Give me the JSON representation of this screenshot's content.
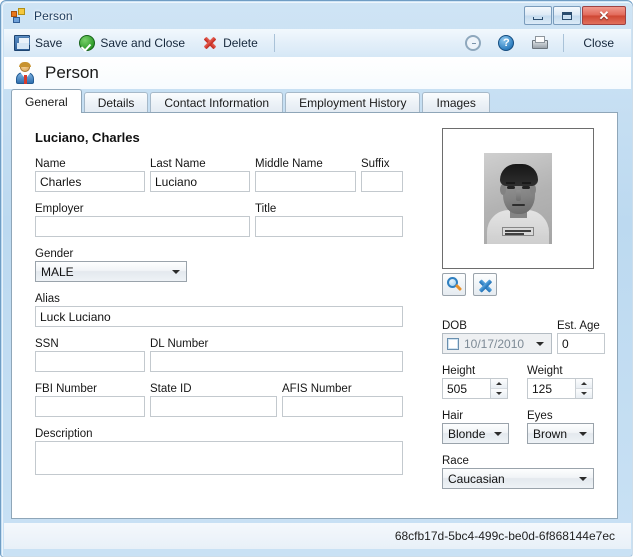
{
  "window": {
    "title": "Person",
    "app_icon": "app-squares-icon",
    "controls": {
      "minimize": "minimize-button",
      "maximize": "maximize-button",
      "close": "close-button"
    }
  },
  "toolbar": {
    "save_label": "Save",
    "save_and_close_label": "Save and Close",
    "delete_label": "Delete",
    "close_label": "Close",
    "icons": {
      "save": "floppy-disk-icon",
      "save_and_close": "green-check-icon",
      "delete": "red-x-icon",
      "history": "clock-history-icon",
      "help": "help-question-icon",
      "print": "printer-icon"
    }
  },
  "header": {
    "title": "Person",
    "icon": "person-icon"
  },
  "tabs": [
    {
      "label": "General",
      "active": true
    },
    {
      "label": "Details",
      "active": false
    },
    {
      "label": "Contact Information",
      "active": false
    },
    {
      "label": "Employment History",
      "active": false
    },
    {
      "label": "Images",
      "active": false
    }
  ],
  "form": {
    "record_title": "Luciano, Charles",
    "name": {
      "label": "Name",
      "value": "Charles"
    },
    "last_name": {
      "label": "Last Name",
      "value": "Luciano"
    },
    "middle_name": {
      "label": "Middle Name",
      "value": ""
    },
    "suffix": {
      "label": "Suffix",
      "value": ""
    },
    "employer": {
      "label": "Employer",
      "value": ""
    },
    "title": {
      "label": "Title",
      "value": ""
    },
    "gender": {
      "label": "Gender",
      "value": "MALE"
    },
    "alias": {
      "label": "Alias",
      "value": "Luck Luciano"
    },
    "ssn": {
      "label": "SSN",
      "value": ""
    },
    "dl_number": {
      "label": "DL Number",
      "value": ""
    },
    "fbi_number": {
      "label": "FBI Number",
      "value": ""
    },
    "state_id": {
      "label": "State ID",
      "value": ""
    },
    "afis_number": {
      "label": "AFIS Number",
      "value": ""
    },
    "description": {
      "label": "Description",
      "value": ""
    },
    "dob": {
      "label": "DOB",
      "value": "10/17/2010",
      "enabled": false
    },
    "est_age": {
      "label": "Est. Age",
      "value": "0"
    },
    "height": {
      "label": "Height",
      "value": "505"
    },
    "weight": {
      "label": "Weight",
      "value": "125"
    },
    "hair": {
      "label": "Hair",
      "value": "Blonde"
    },
    "eyes": {
      "label": "Eyes",
      "value": "Brown"
    },
    "race": {
      "label": "Race",
      "value": "Caucasian"
    }
  },
  "photo": {
    "alt": "mugshot-photo",
    "zoom_button": "magnifier-icon",
    "remove_button": "blue-x-icon"
  },
  "statusbar": {
    "guid": "68cfb17d-5bc4-499c-be0d-6f868144e7ec"
  },
  "colors": {
    "frame": "#bcd9f0",
    "accent": "#2f7fc0",
    "close": "#cf4632"
  }
}
